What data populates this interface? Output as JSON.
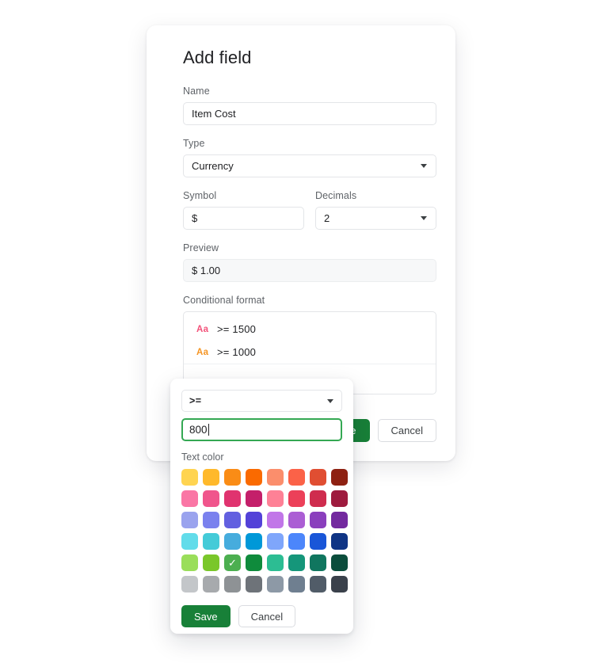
{
  "dialog": {
    "title": "Add field",
    "name": {
      "label": "Name",
      "value": "Item Cost"
    },
    "type": {
      "label": "Type",
      "value": "Currency"
    },
    "symbol": {
      "label": "Symbol",
      "value": "$"
    },
    "decimals": {
      "label": "Decimals",
      "value": "2"
    },
    "preview": {
      "label": "Preview",
      "value": "$ 1.00"
    },
    "conditional_format": {
      "label": "Conditional format",
      "rules": [
        {
          "icon_label": "Aa",
          "color": "#f3527a",
          "condition": ">= 1500"
        },
        {
          "icon_label": "Aa",
          "color": "#f59524",
          "condition": ">= 1000"
        }
      ]
    },
    "save_label": "Save",
    "cancel_label": "Cancel"
  },
  "popup": {
    "operator": {
      "value": ">="
    },
    "value_input": {
      "value": "800"
    },
    "text_color_label": "Text color",
    "save_label": "Save",
    "cancel_label": "Cancel",
    "selected_swatch_index": 34,
    "selected_color": "#4caf50",
    "check_glyph": "✓",
    "swatches": [
      "#ffd451",
      "#ffb92b",
      "#fa8c16",
      "#fa6a00",
      "#fb8e6c",
      "#fb6248",
      "#e04e32",
      "#8e2112",
      "#fa76a5",
      "#f0558c",
      "#e0336f",
      "#c41f6a",
      "#fe8196",
      "#ec4059",
      "#cf2c4e",
      "#9e1b3e",
      "#9aa3ee",
      "#7a81ee",
      "#6260e0",
      "#5342d8",
      "#c176e8",
      "#ab5ed4",
      "#8a3fbd",
      "#73299f",
      "#62dcea",
      "#44cbd8",
      "#46acdd",
      "#0098d8",
      "#7fa6fb",
      "#4c86fb",
      "#1a56d8",
      "#0f3485",
      "#9ade5a",
      "#7ac72a",
      "#4caf50",
      "#0f8b3c",
      "#2cbd93",
      "#15967a",
      "#10765f",
      "#0b4d3c",
      "#c3c6c9",
      "#a7aaad",
      "#8e9295",
      "#6e7379",
      "#8d99a6",
      "#6f7f90",
      "#515c68",
      "#3a414b"
    ]
  }
}
